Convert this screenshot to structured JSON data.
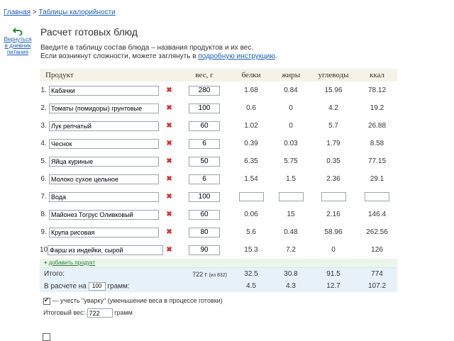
{
  "breadcrumbs": {
    "home": "Главная",
    "sep": ">",
    "current": "Таблицы калорийности"
  },
  "back_link": {
    "line1": "Вернуться",
    "line2": "в дневник",
    "line3": "питания"
  },
  "page_title": "Расчет готовых блюд",
  "intro": {
    "line1": "Введите в таблицу состав блюда – названия продуктов и их вес.",
    "line2_prefix": "Если возникнут сложности, можете заглянуть в ",
    "link": "подробную инструкцию",
    "line2_suffix": "."
  },
  "columns": {
    "product": "Продукт",
    "weight": "вес, г",
    "protein": "белки",
    "fat": "жиры",
    "carbs": "углеводы",
    "kcal": "ккал"
  },
  "delete_glyph": "✖",
  "rows": [
    {
      "num": "1.",
      "name": "Кабачки",
      "weight": "280",
      "protein": "1.68",
      "fat": "0.84",
      "carbs": "15.96",
      "kcal": "78.12"
    },
    {
      "num": "2.",
      "name": "Томаты (помидоры) грунтовые",
      "weight": "100",
      "protein": "0.6",
      "fat": "0",
      "carbs": "4.2",
      "kcal": "19.2"
    },
    {
      "num": "3.",
      "name": "Лук репчатый",
      "weight": "60",
      "protein": "1.02",
      "fat": "0",
      "carbs": "5.7",
      "kcal": "26.88"
    },
    {
      "num": "4.",
      "name": "Чеснок",
      "weight": "6",
      "protein": "0.39",
      "fat": "0.03",
      "carbs": "1.79",
      "kcal": "8.58"
    },
    {
      "num": "5.",
      "name": "Яйца куриные",
      "weight": "50",
      "protein": "6.35",
      "fat": "5.75",
      "carbs": "0.35",
      "kcal": "77.15"
    },
    {
      "num": "6.",
      "name": "Молоко сухое цельное",
      "weight": "6",
      "protein": "1.54",
      "fat": "1.5",
      "carbs": "2.36",
      "kcal": "29.1"
    },
    {
      "num": "7.",
      "name": "Вода",
      "weight": "100",
      "protein": "",
      "fat": "",
      "carbs": "",
      "kcal": ""
    },
    {
      "num": "8.",
      "name": "Майонез Тогрус Оливковый",
      "weight": "60",
      "protein": "0.06",
      "fat": "15",
      "carbs": "2.16",
      "kcal": "146.4"
    },
    {
      "num": "9.",
      "name": "Крупа рисовая",
      "weight": "80",
      "protein": "5.6",
      "fat": "0.48",
      "carbs": "58.96",
      "kcal": "262.56"
    },
    {
      "num": "10.",
      "name": "Фарш из индейки, сырой",
      "weight": "90",
      "protein": "15.3",
      "fat": "7.2",
      "carbs": "0",
      "kcal": "126"
    }
  ],
  "add_product": {
    "plus": "+",
    "label": "добавить продукт"
  },
  "totals": {
    "label": "Итого:",
    "weight": "722 г",
    "weight_note": "(из 832)",
    "protein": "32.5",
    "fat": "30.8",
    "carbs": "91.5",
    "kcal": "774"
  },
  "per": {
    "prefix": "В расчете на",
    "amount": "100",
    "suffix": "грамм:",
    "protein": "4.5",
    "fat": "4.3",
    "carbs": "12.7",
    "kcal": "107.2"
  },
  "option": {
    "checked": true,
    "label": "— учесть \"уварку\" (уменьшение веса в процессе готовки)"
  },
  "final_weight": {
    "label": "Итоговый вес:",
    "value": "722",
    "unit": "грамм"
  },
  "colors": {
    "link": "#1a5fb4",
    "header_bg": "#f5f3e7",
    "totals_bg": "#e6f1f9",
    "add_bg": "#eaf6ea",
    "delete": "#cc3333",
    "back_arrow": "#2e8b3a"
  }
}
